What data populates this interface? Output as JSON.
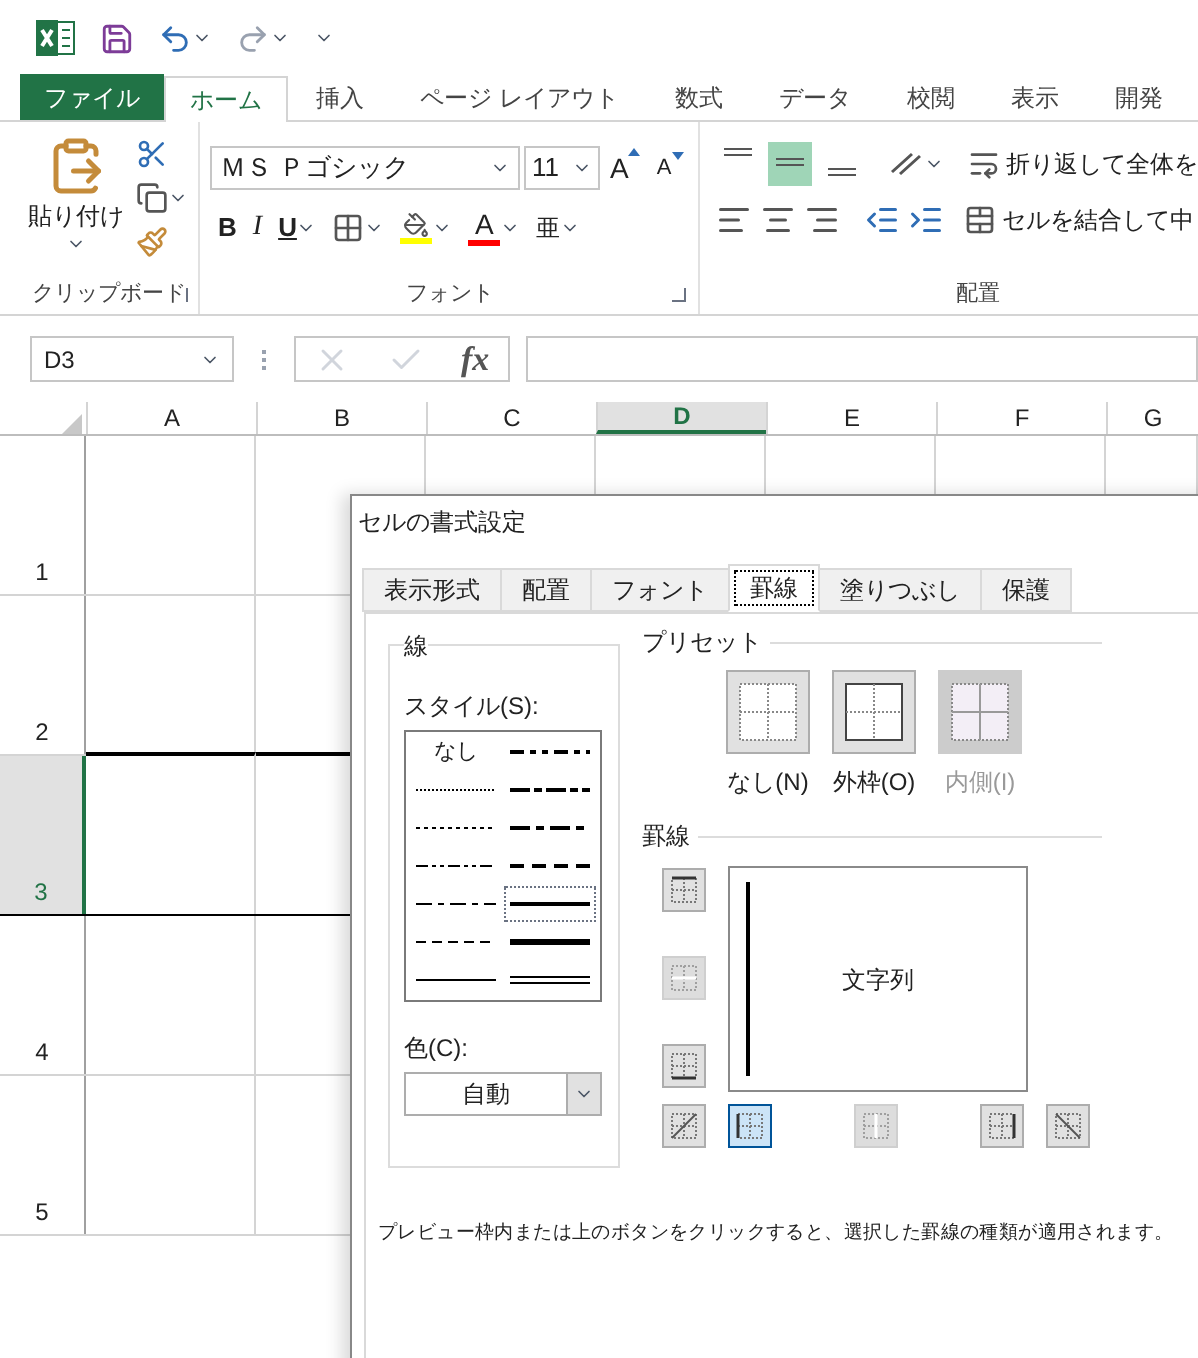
{
  "ribbon_tabs": [
    {
      "label": "ファイル",
      "kind": "file",
      "selected": false
    },
    {
      "label": "ホーム",
      "kind": "tab",
      "selected": true
    },
    {
      "label": "挿入",
      "kind": "tab",
      "selected": false
    },
    {
      "label": "ページ レイアウト",
      "kind": "tab",
      "selected": false
    },
    {
      "label": "数式",
      "kind": "tab",
      "selected": false
    },
    {
      "label": "データ",
      "kind": "tab",
      "selected": false
    },
    {
      "label": "校閲",
      "kind": "tab",
      "selected": false
    },
    {
      "label": "表示",
      "kind": "tab",
      "selected": false
    },
    {
      "label": "開発",
      "kind": "tab",
      "selected": false
    }
  ],
  "ribbon": {
    "clipboard": {
      "paste": "貼り付け",
      "group": "クリップボード"
    },
    "font": {
      "name": "ＭＳ Ｐゴシック",
      "size": "11",
      "grow": "A",
      "shrink": "A",
      "bold": "B",
      "italic": "I",
      "underline": "U",
      "font_color": "A",
      "phonetic": "亜",
      "group": "フォント"
    },
    "alignment": {
      "vertical": [
        {
          "kind": "top",
          "selected": false
        },
        {
          "kind": "middle",
          "selected": true
        },
        {
          "kind": "bottom",
          "selected": false
        }
      ],
      "wrap": "折り返して全体を",
      "merge": "セルを結合して中",
      "group": "配置"
    }
  },
  "formula_bar": {
    "name_box": "D3",
    "fx": "fx"
  },
  "sheet": {
    "columns": [
      {
        "label": "A",
        "selected": false
      },
      {
        "label": "B",
        "selected": false
      },
      {
        "label": "C",
        "selected": false
      },
      {
        "label": "D",
        "selected": true
      },
      {
        "label": "E",
        "selected": false
      },
      {
        "label": "F",
        "selected": false
      },
      {
        "label": "G",
        "selected": false
      }
    ],
    "rows": [
      {
        "label": "1",
        "selected": false,
        "bordered": false
      },
      {
        "label": "2",
        "selected": false,
        "bordered": false
      },
      {
        "label": "3",
        "selected": true,
        "bordered": true
      },
      {
        "label": "4",
        "selected": false,
        "bordered": false
      },
      {
        "label": "5",
        "selected": false,
        "bordered": false
      }
    ]
  },
  "dialog": {
    "title": "セルの書式設定",
    "tabs": [
      {
        "label": "表示形式",
        "selected": false
      },
      {
        "label": "配置",
        "selected": false
      },
      {
        "label": "フォント",
        "selected": false
      },
      {
        "label": "罫線",
        "selected": true
      },
      {
        "label": "塗りつぶし",
        "selected": false
      },
      {
        "label": "保護",
        "selected": false
      }
    ],
    "line": {
      "title": "線",
      "style_label": "スタイル(S):",
      "styles": [
        {
          "kind": "none",
          "label": "なし",
          "selected": false
        },
        {
          "kind": "medium-dash-dot-dot",
          "selected": false
        },
        {
          "kind": "hair",
          "selected": false
        },
        {
          "kind": "slant-dash-dot",
          "selected": false
        },
        {
          "kind": "dotted",
          "selected": false
        },
        {
          "kind": "medium-dash-dot",
          "selected": false
        },
        {
          "kind": "dash-dot-dot",
          "selected": false
        },
        {
          "kind": "medium-dashed",
          "selected": false
        },
        {
          "kind": "dash-dot",
          "selected": false
        },
        {
          "kind": "medium",
          "selected": true
        },
        {
          "kind": "dashed",
          "selected": false
        },
        {
          "kind": "thick",
          "selected": false
        },
        {
          "kind": "thin",
          "selected": false
        },
        {
          "kind": "double",
          "selected": false
        }
      ],
      "color_label": "色(C):",
      "color_value": "自動"
    },
    "preset": {
      "title": "プリセット",
      "buttons": [
        {
          "kind": "none",
          "label": "なし(N)",
          "disabled": false
        },
        {
          "kind": "outline",
          "label": "外枠(O)",
          "disabled": false
        },
        {
          "kind": "inside",
          "label": "内側(I)",
          "disabled": true
        }
      ]
    },
    "border": {
      "title": "罫線",
      "preview_text": "文字列",
      "buttons": [
        {
          "kind": "top",
          "on": false,
          "disabled": false
        },
        {
          "kind": "middle-h",
          "on": false,
          "disabled": true
        },
        {
          "kind": "bottom",
          "on": false,
          "disabled": false
        },
        {
          "kind": "diag-up",
          "on": false,
          "disabled": false
        },
        {
          "kind": "left",
          "on": true,
          "disabled": false
        },
        {
          "kind": "middle-v",
          "on": false,
          "disabled": true
        },
        {
          "kind": "right",
          "on": false,
          "disabled": false
        },
        {
          "kind": "diag-down",
          "on": false,
          "disabled": false
        }
      ]
    },
    "hint": "プレビュー枠内または上のボタンをクリックすると、選択した罫線の種類が適用されます。"
  }
}
